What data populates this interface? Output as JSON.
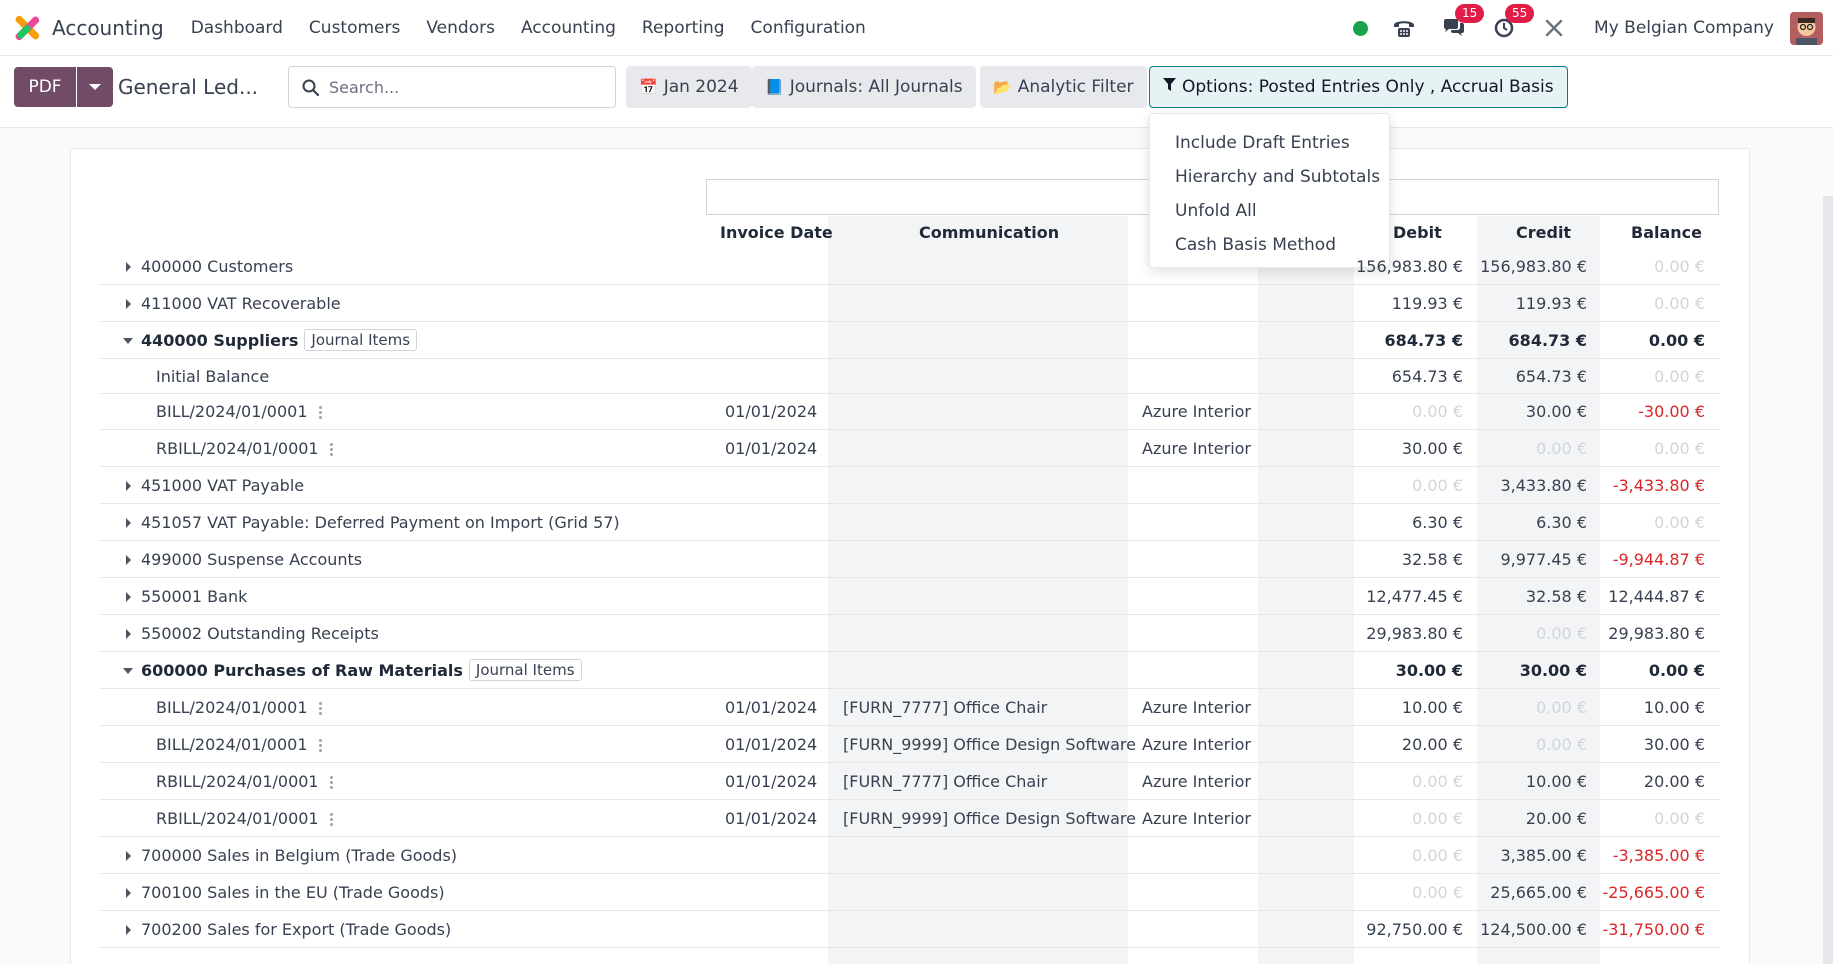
{
  "app": {
    "name": "Accounting",
    "menu": [
      "Dashboard",
      "Customers",
      "Vendors",
      "Accounting",
      "Reporting",
      "Configuration"
    ],
    "messages_badge": "15",
    "activities_badge": "55",
    "company": "My Belgian Company",
    "status_color": "#16a34a",
    "accent_color": "#714b67"
  },
  "control": {
    "pdf_label": "PDF",
    "title": "General Led...",
    "search_placeholder": "Search...",
    "date_filter": "Jan 2024",
    "journals_filter": "Journals: All Journals",
    "analytic_filter": "Analytic Filter",
    "options_filter": "Options: Posted Entries Only , Accrual Basis"
  },
  "options_menu": [
    "Include Draft Entries",
    "Hierarchy and Subtotals",
    "Unfold All",
    "Cash Basis Method"
  ],
  "table": {
    "headers": {
      "invoice_date": "Invoice Date",
      "communication": "Communication",
      "debit": "Debit",
      "credit": "Credit",
      "balance": "Balance"
    },
    "journal_items_label": "Journal Items",
    "rows": [
      {
        "type": "account",
        "expanded": false,
        "label": "400000 Customers",
        "debit": "156,983.80 €",
        "credit": "156,983.80 €",
        "balance": "0.00 €"
      },
      {
        "type": "account",
        "expanded": false,
        "label": "411000 VAT Recoverable",
        "debit": "119.93 €",
        "credit": "119.93 €",
        "balance": "0.00 €"
      },
      {
        "type": "account",
        "expanded": true,
        "label": "440000 Suppliers",
        "debit": "684.73 €",
        "credit": "684.73 €",
        "balance": "0.00 €"
      },
      {
        "type": "initial",
        "label": "Initial Balance",
        "debit": "654.73 €",
        "credit": "654.73 €",
        "balance": "0.00 €"
      },
      {
        "type": "line",
        "label": "BILL/2024/01/0001",
        "date": "01/01/2024",
        "communication": "",
        "partner": "Azure Interior",
        "debit": "0.00 €",
        "credit": "30.00 €",
        "balance": "-30.00 €"
      },
      {
        "type": "line",
        "label": "RBILL/2024/01/0001",
        "date": "01/01/2024",
        "communication": "",
        "partner": "Azure Interior",
        "debit": "30.00 €",
        "credit": "0.00 €",
        "balance": "0.00 €"
      },
      {
        "type": "account",
        "expanded": false,
        "label": "451000 VAT Payable",
        "debit": "0.00 €",
        "credit": "3,433.80 €",
        "balance": "-3,433.80 €"
      },
      {
        "type": "account",
        "expanded": false,
        "label": "451057 VAT Payable: Deferred Payment on Import (Grid 57)",
        "debit": "6.30 €",
        "credit": "6.30 €",
        "balance": "0.00 €"
      },
      {
        "type": "account",
        "expanded": false,
        "label": "499000 Suspense Accounts",
        "debit": "32.58 €",
        "credit": "9,977.45 €",
        "balance": "-9,944.87 €"
      },
      {
        "type": "account",
        "expanded": false,
        "label": "550001 Bank",
        "debit": "12,477.45 €",
        "credit": "32.58 €",
        "balance": "12,444.87 €"
      },
      {
        "type": "account",
        "expanded": false,
        "label": "550002 Outstanding Receipts",
        "debit": "29,983.80 €",
        "credit": "0.00 €",
        "balance": "29,983.80 €"
      },
      {
        "type": "account",
        "expanded": true,
        "label": "600000 Purchases of Raw Materials",
        "debit": "30.00 €",
        "credit": "30.00 €",
        "balance": "0.00 €"
      },
      {
        "type": "line",
        "label": "BILL/2024/01/0001",
        "date": "01/01/2024",
        "communication": "[FURN_7777] Office Chair",
        "partner": "Azure Interior",
        "debit": "10.00 €",
        "credit": "0.00 €",
        "balance": "10.00 €"
      },
      {
        "type": "line",
        "label": "BILL/2024/01/0001",
        "date": "01/01/2024",
        "communication": "[FURN_9999] Office Design Software",
        "partner": "Azure Interior",
        "debit": "20.00 €",
        "credit": "0.00 €",
        "balance": "30.00 €"
      },
      {
        "type": "line",
        "label": "RBILL/2024/01/0001",
        "date": "01/01/2024",
        "communication": "[FURN_7777] Office Chair",
        "partner": "Azure Interior",
        "debit": "0.00 €",
        "credit": "10.00 €",
        "balance": "20.00 €"
      },
      {
        "type": "line",
        "label": "RBILL/2024/01/0001",
        "date": "01/01/2024",
        "communication": "[FURN_9999] Office Design Software",
        "partner": "Azure Interior",
        "debit": "0.00 €",
        "credit": "20.00 €",
        "balance": "0.00 €"
      },
      {
        "type": "account",
        "expanded": false,
        "label": "700000 Sales in Belgium (Trade Goods)",
        "debit": "0.00 €",
        "credit": "3,385.00 €",
        "balance": "-3,385.00 €"
      },
      {
        "type": "account",
        "expanded": false,
        "label": "700100 Sales in the EU (Trade Goods)",
        "debit": "0.00 €",
        "credit": "25,665.00 €",
        "balance": "-25,665.00 €"
      },
      {
        "type": "account",
        "expanded": false,
        "label": "700200 Sales for Export (Trade Goods)",
        "debit": "92,750.00 €",
        "credit": "124,500.00 €",
        "balance": "-31,750.00 €"
      }
    ]
  }
}
